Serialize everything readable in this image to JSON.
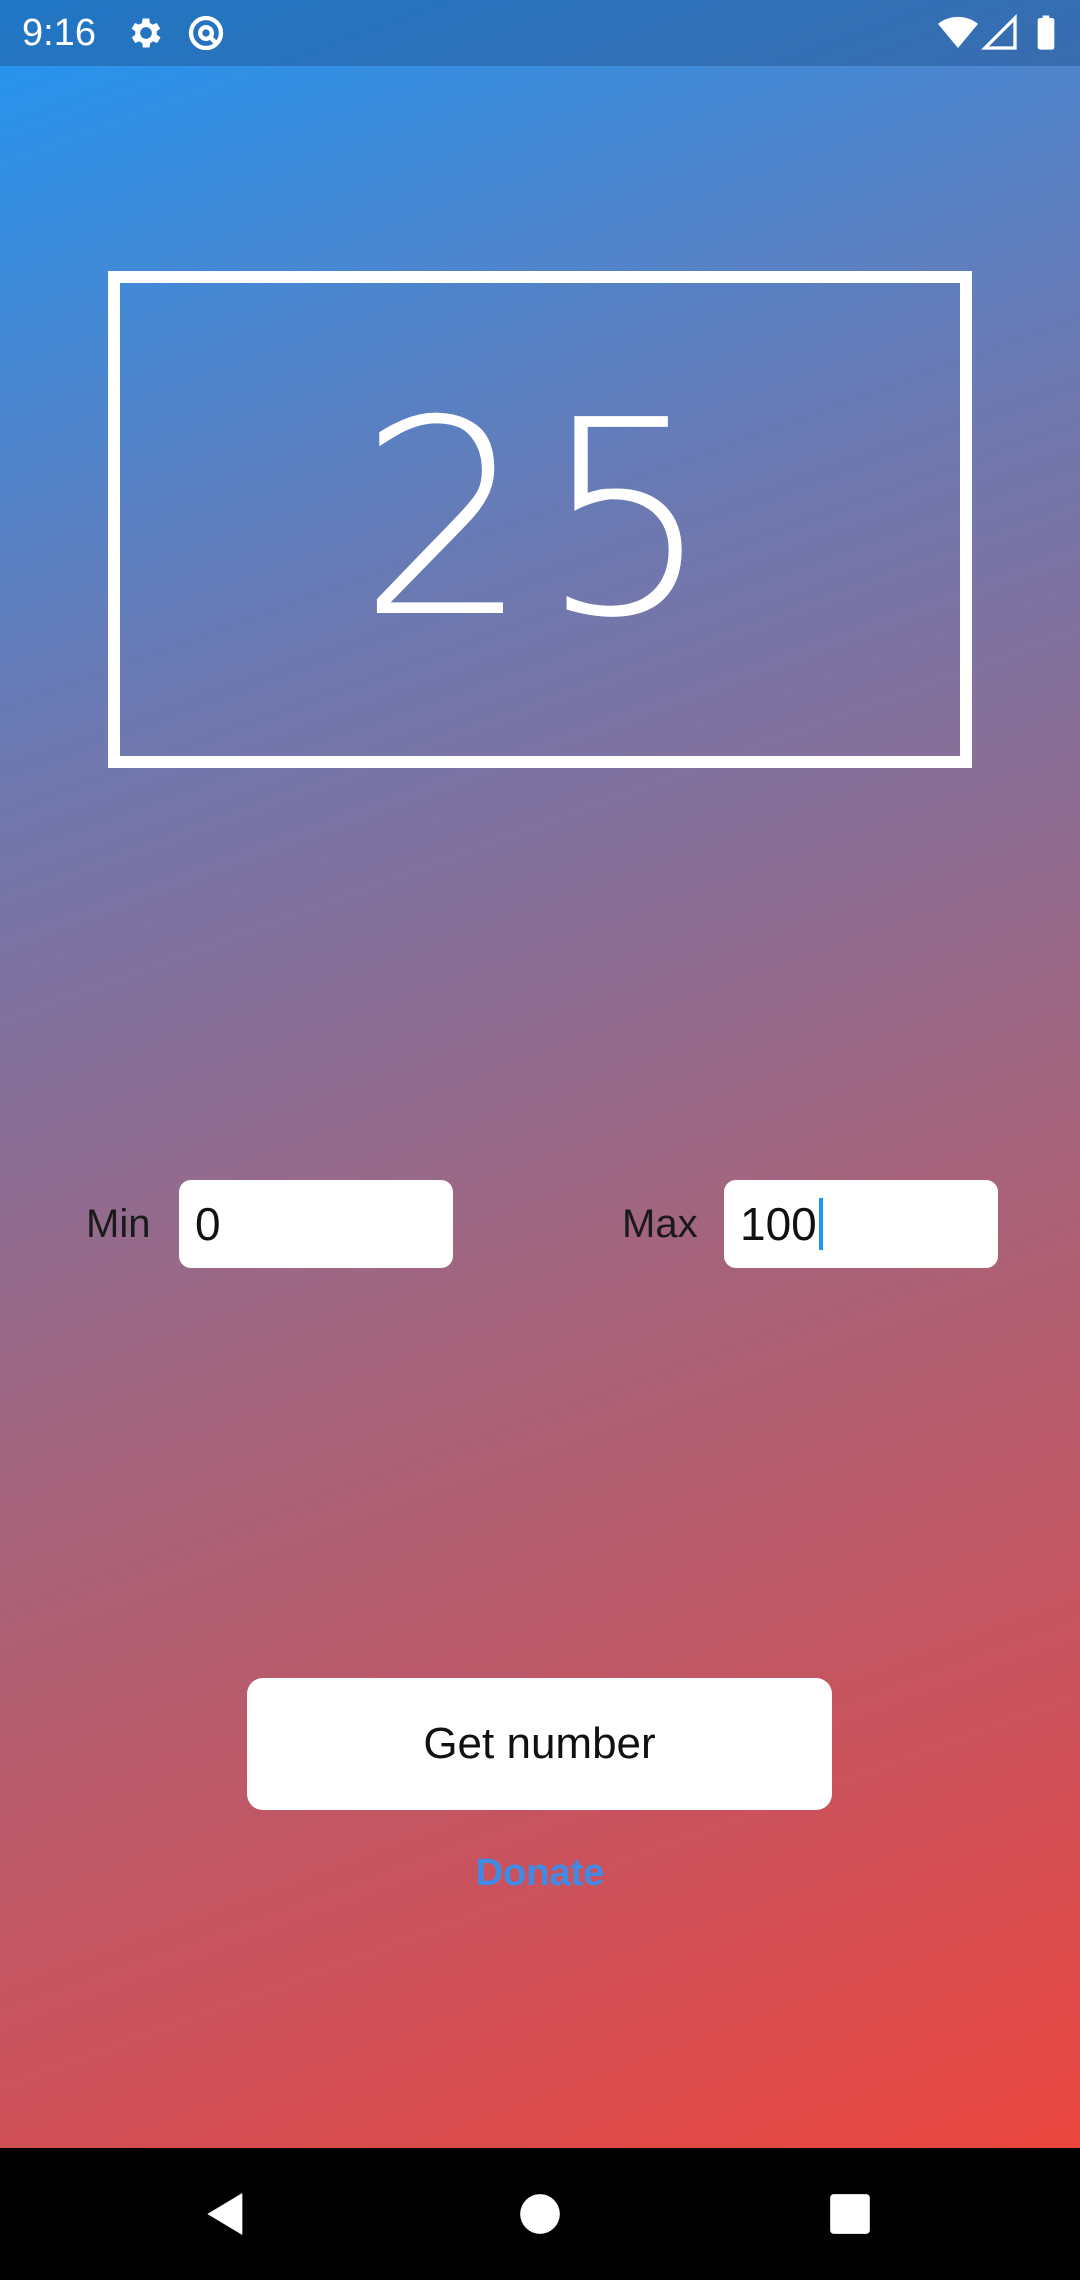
{
  "status_bar": {
    "time": "9:16",
    "left_icons": [
      "gear-icon",
      "at-icon"
    ],
    "right_icons": [
      "wifi-icon",
      "cell-signal-icon",
      "battery-icon"
    ]
  },
  "display": {
    "number": "25"
  },
  "range": {
    "min_label": "Min",
    "min_value": "0",
    "max_label": "Max",
    "max_value": "100"
  },
  "actions": {
    "get_number_label": "Get number",
    "donate_label": "Donate"
  },
  "nav_bar": {
    "buttons": [
      "back-icon",
      "home-icon",
      "recents-icon"
    ]
  },
  "colors": {
    "gradient_start": "#2196F3",
    "gradient_end": "#F44336",
    "donate_link": "#3f8be6",
    "caret": "#2196F3"
  }
}
